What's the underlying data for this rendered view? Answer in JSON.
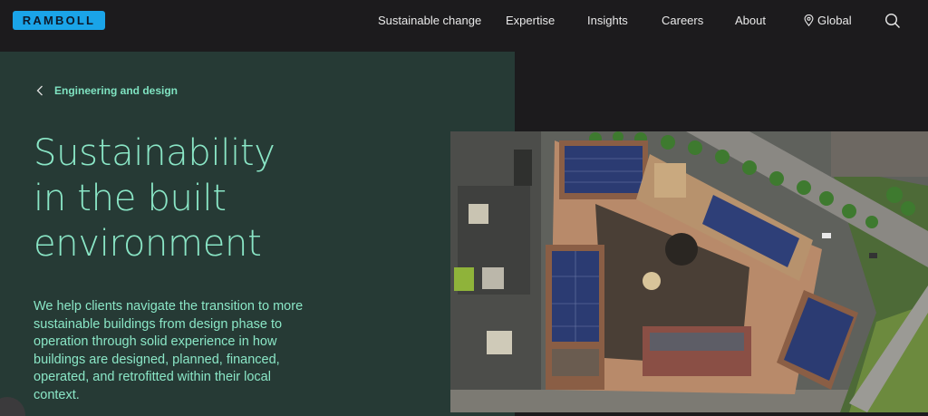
{
  "header": {
    "logo_text": "RAMBOLL",
    "nav": {
      "sustainable_change": "Sustainable change",
      "expertise": "Expertise",
      "insights": "Insights",
      "careers": "Careers",
      "about": "About",
      "global": "Global"
    },
    "icons": {
      "location": "location-pin-icon",
      "search": "search-icon"
    }
  },
  "hero": {
    "breadcrumb": "Engineering and design",
    "title_lines": [
      "Sustainability",
      "in the built",
      "environment"
    ],
    "intro": "We help clients navigate the transition to more sustainable buildings from design phase to operation through solid experience in how buildings are designed, planned, financed, operated, and retrofitted within their local context."
  },
  "colors": {
    "background": "#1c1b1d",
    "panel": "#263a35",
    "accent_text": "#8ae6c6",
    "logo_blue": "#1aa4e8"
  }
}
